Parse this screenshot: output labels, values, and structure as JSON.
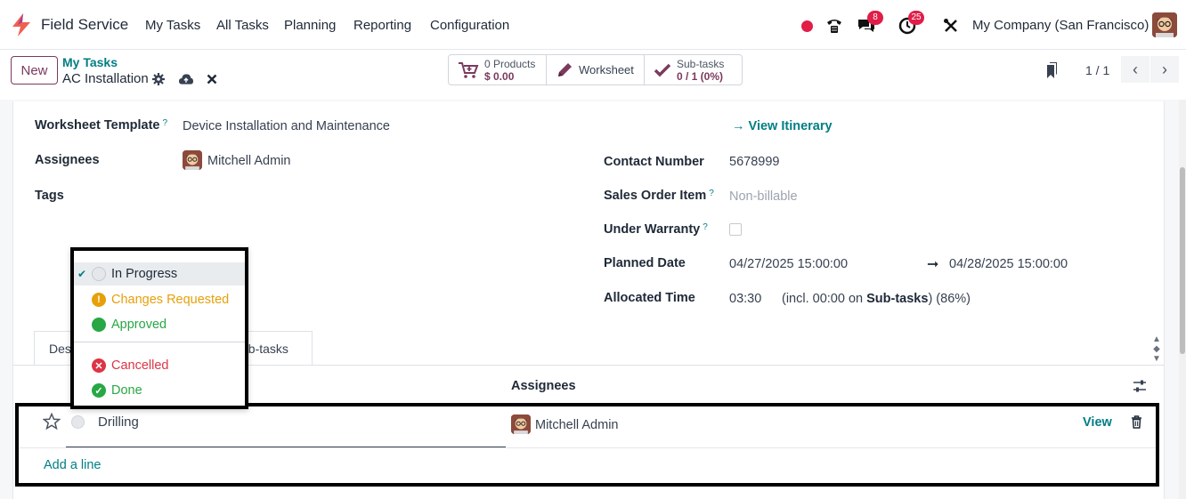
{
  "navbar": {
    "app_name": "Field Service",
    "menu": [
      "My Tasks",
      "All Tasks",
      "Planning",
      "Reporting",
      "Configuration"
    ],
    "messages_count": "8",
    "activities_count": "25",
    "company": "My Company (San Francisco)",
    "icons": [
      "app-logo-icon",
      "status-dot-icon",
      "phone-icon",
      "chat-icon",
      "clock-icon",
      "tools-icon",
      "user-avatar"
    ]
  },
  "control_panel": {
    "new_label": "New",
    "breadcrumb_parent": "My Tasks",
    "breadcrumb_current": "AC Installation",
    "smart_buttons": {
      "products_count": "0 Products",
      "products_amount": "$ 0.00",
      "worksheet": "Worksheet",
      "subtasks_label": "Sub-tasks",
      "subtasks_value": "0 / 1 (0%)"
    },
    "pager": "1 / 1"
  },
  "form": {
    "worksheet_template_label": "Worksheet Template",
    "worksheet_template_value": "Device Installation and Maintenance",
    "assignees_label": "Assignees",
    "assignees_value": "Mitchell Admin",
    "tags_label": "Tags",
    "view_itinerary": "View Itinerary",
    "contact_number_label": "Contact Number",
    "contact_number_value": "5678999",
    "sales_order_item_label": "Sales Order Item",
    "sales_order_item_value": "Non-billable",
    "under_warranty_label": "Under Warranty",
    "planned_date_label": "Planned Date",
    "planned_date_start": "04/27/2025 15:00:00",
    "planned_date_end": "04/28/2025 15:00:00",
    "allocated_time_label": "Allocated Time",
    "allocated_time_value": "03:30",
    "allocated_time_detail_prefix": "(incl. 00:00 on",
    "allocated_time_detail_bold": "Sub-tasks",
    "allocated_time_detail_suffix": ") (86%)",
    "help_mark": "?"
  },
  "tabs": {
    "description_partial": "Des",
    "subtasks_partial": "ub-tasks"
  },
  "subtasks_list": {
    "col_assignees": "Assignees",
    "rows": [
      {
        "name": "Drilling",
        "assignee": "Mitchell Admin",
        "action": "View"
      }
    ],
    "add_line": "Add a line"
  },
  "state_dropdown": {
    "items": [
      {
        "label": "In Progress",
        "color": "#1f2937",
        "checked": true
      },
      {
        "label": "Changes Requested",
        "color": "#e6a00a"
      },
      {
        "label": "Approved",
        "color": "#28a745"
      },
      {
        "label": "Cancelled",
        "color": "#dc3545"
      },
      {
        "label": "Done",
        "color": "#28a745"
      }
    ]
  }
}
